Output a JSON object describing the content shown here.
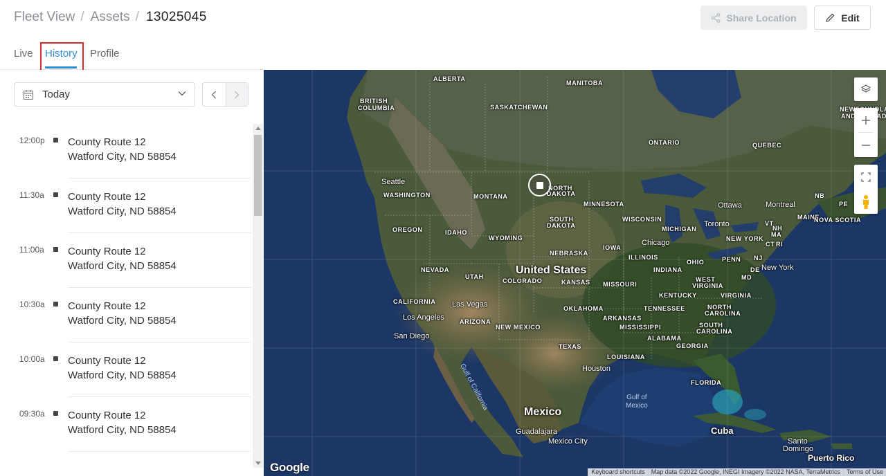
{
  "breadcrumb": {
    "items": [
      "Fleet View",
      "Assets"
    ],
    "separator": "/",
    "current": "13025045"
  },
  "actions": {
    "share_label": "Share Location",
    "edit_label": "Edit"
  },
  "tabs": [
    {
      "label": "Live",
      "active": false
    },
    {
      "label": "History",
      "active": true
    },
    {
      "label": "Profile",
      "active": false
    }
  ],
  "date_filter": {
    "selected": "Today"
  },
  "history": [
    {
      "time": "12:00p",
      "line1": "County Route 12",
      "line2": "Watford City, ND 58854"
    },
    {
      "time": "11:30a",
      "line1": "County Route 12",
      "line2": "Watford City, ND 58854"
    },
    {
      "time": "11:00a",
      "line1": "County Route 12",
      "line2": "Watford City, ND 58854"
    },
    {
      "time": "10:30a",
      "line1": "County Route 12",
      "line2": "Watford City, ND 58854"
    },
    {
      "time": "10:00a",
      "line1": "County Route 12",
      "line2": "Watford City, ND 58854"
    },
    {
      "time": "09:30a",
      "line1": "County Route 12",
      "line2": "Watford City, ND 58854"
    }
  ],
  "map": {
    "regions": {
      "alberta": "ALBERTA",
      "manitoba": "MANITOBA",
      "british_columbia_1": "BRITISH",
      "british_columbia_2": "COLUMBIA",
      "saskatchewan": "SASKATCHEWAN",
      "ontario": "ONTARIO",
      "quebec": "QUEBEC",
      "newfoundland_1": "NEWFOUNDLAND",
      "newfoundland_2": "AND LABRADOR",
      "washington": "WASHINGTON",
      "montana": "MONTANA",
      "north_dakota_1": "NORTH",
      "north_dakota_2": "DAKOTA",
      "minnesota": "MINNESOTA",
      "south_dakota_1": "SOUTH",
      "south_dakota_2": "DAKOTA",
      "oregon": "OREGON",
      "idaho": "IDAHO",
      "wyoming": "WYOMING",
      "wisconsin": "WISCONSIN",
      "michigan": "MICHIGAN",
      "nebraska": "NEBRASKA",
      "iowa": "IOWA",
      "illinois": "ILLINOIS",
      "indiana": "INDIANA",
      "ohio": "OHIO",
      "penn": "PENN",
      "new_york": "NEW YORK",
      "nevada": "NEVADA",
      "utah": "UTAH",
      "colorado": "COLORADO",
      "kansas": "KANSAS",
      "missouri": "MISSOURI",
      "west_virginia_1": "WEST",
      "west_virginia_2": "VIRGINIA",
      "virginia": "VIRGINIA",
      "kentucky": "KENTUCKY",
      "california": "CALIFORNIA",
      "oklahoma": "OKLAHOMA",
      "tennessee": "TENNESSEE",
      "north_carolina_1": "NORTH",
      "north_carolina_2": "CAROLINA",
      "arizona": "ARIZONA",
      "new_mexico": "NEW MEXICO",
      "arkansas": "ARKANSAS",
      "mississippi": "MISSISSIPPI",
      "south_carolina_1": "SOUTH",
      "south_carolina_2": "CAROLINA",
      "alabama": "ALABAMA",
      "georgia": "GEORGIA",
      "texas": "TEXAS",
      "louisiana": "LOUISIANA",
      "florida": "FLORIDA",
      "vt": "VT",
      "nh": "NH",
      "ma": "MA",
      "ct": "CT",
      "ri": "RI",
      "nj": "NJ",
      "de": "DE",
      "md": "MD",
      "maine": "MAINE",
      "nova_scotia": "NOVA SCOTIA",
      "nb": "NB",
      "pe": "PE"
    },
    "cities": {
      "seattle": "Seattle",
      "las_vegas": "Las Vegas",
      "los_angeles": "Los Angeles",
      "san_diego": "San Diego",
      "chicago": "Chicago",
      "ottawa": "Ottawa",
      "montreal": "Montreal",
      "toronto": "Toronto",
      "new_york": "New York",
      "houston": "Houston",
      "guadalajara": "Guadalajara",
      "mexico_city": "Mexico City",
      "santo_domingo_1": "Santo",
      "santo_domingo_2": "Domingo",
      "puerto_rico": "Puerto Rico"
    },
    "countries": {
      "us": "United States",
      "mexico": "Mexico",
      "cuba": "Cuba"
    },
    "water": {
      "gulf_of_mexico_1": "Gulf of",
      "gulf_of_mexico_2": "Mexico",
      "gulf_of_california": "Gulf of California"
    },
    "logo": "Google",
    "attribution": [
      "Keyboard shortcuts",
      "Map data ©2022 Google, INEGI Imagery ©2022 NASA, TerraMetrics",
      "Terms of Use"
    ]
  },
  "colors": {
    "accent": "#2b8fd6",
    "highlight": "#d32f2f",
    "ocean": "#1c3766",
    "land": "#4a5a3a"
  }
}
